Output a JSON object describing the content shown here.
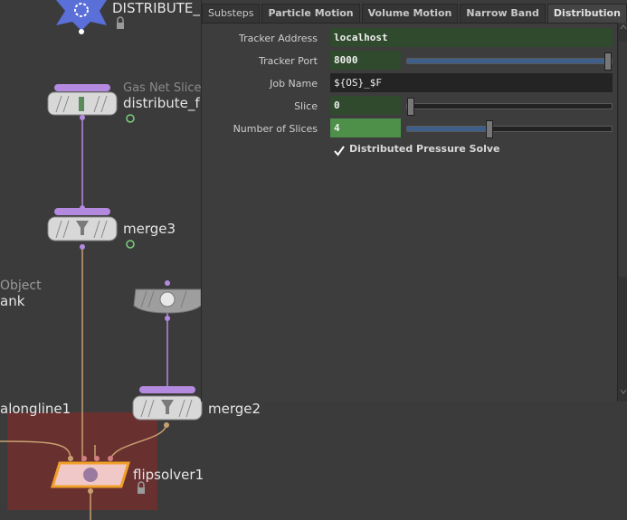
{
  "network": {
    "top_node_label": "DISTRIBUTE_",
    "gas_net_slice_type": "Gas Net Slice",
    "distribute_node_label": "distribute_f",
    "merge3_label": "merge3",
    "object_type": "Object",
    "tank_label": "ank",
    "merge2_label": "merge2",
    "alongline_label": "alongline1",
    "flipsolver_label": "flipsolver1"
  },
  "params": {
    "tabs": [
      "Substeps",
      "Particle Motion",
      "Volume Motion",
      "Narrow Band",
      "Distribution"
    ],
    "active_tab_index": 4,
    "tracker_address": {
      "label": "Tracker Address",
      "value": "localhost"
    },
    "tracker_port": {
      "label": "Tracker Port",
      "value": "8000",
      "slider_fraction": 1.0
    },
    "job_name": {
      "label": "Job Name",
      "value": "${OS}_$F"
    },
    "slice": {
      "label": "Slice",
      "value": "0",
      "slider_fraction": 0.0
    },
    "number_of_slices": {
      "label": "Number of Slices",
      "value": "4",
      "slider_fraction": 0.4
    },
    "distributed_pressure": {
      "label": "Distributed Pressure Solve",
      "checked": true
    }
  },
  "colors": {
    "wire_purple": "#b48ae0",
    "wire_tan": "#c8a070",
    "flip_highlight": "#c83c3c",
    "flip_node_border": "#f0a028",
    "accent_blue": "#5a6fd8"
  }
}
